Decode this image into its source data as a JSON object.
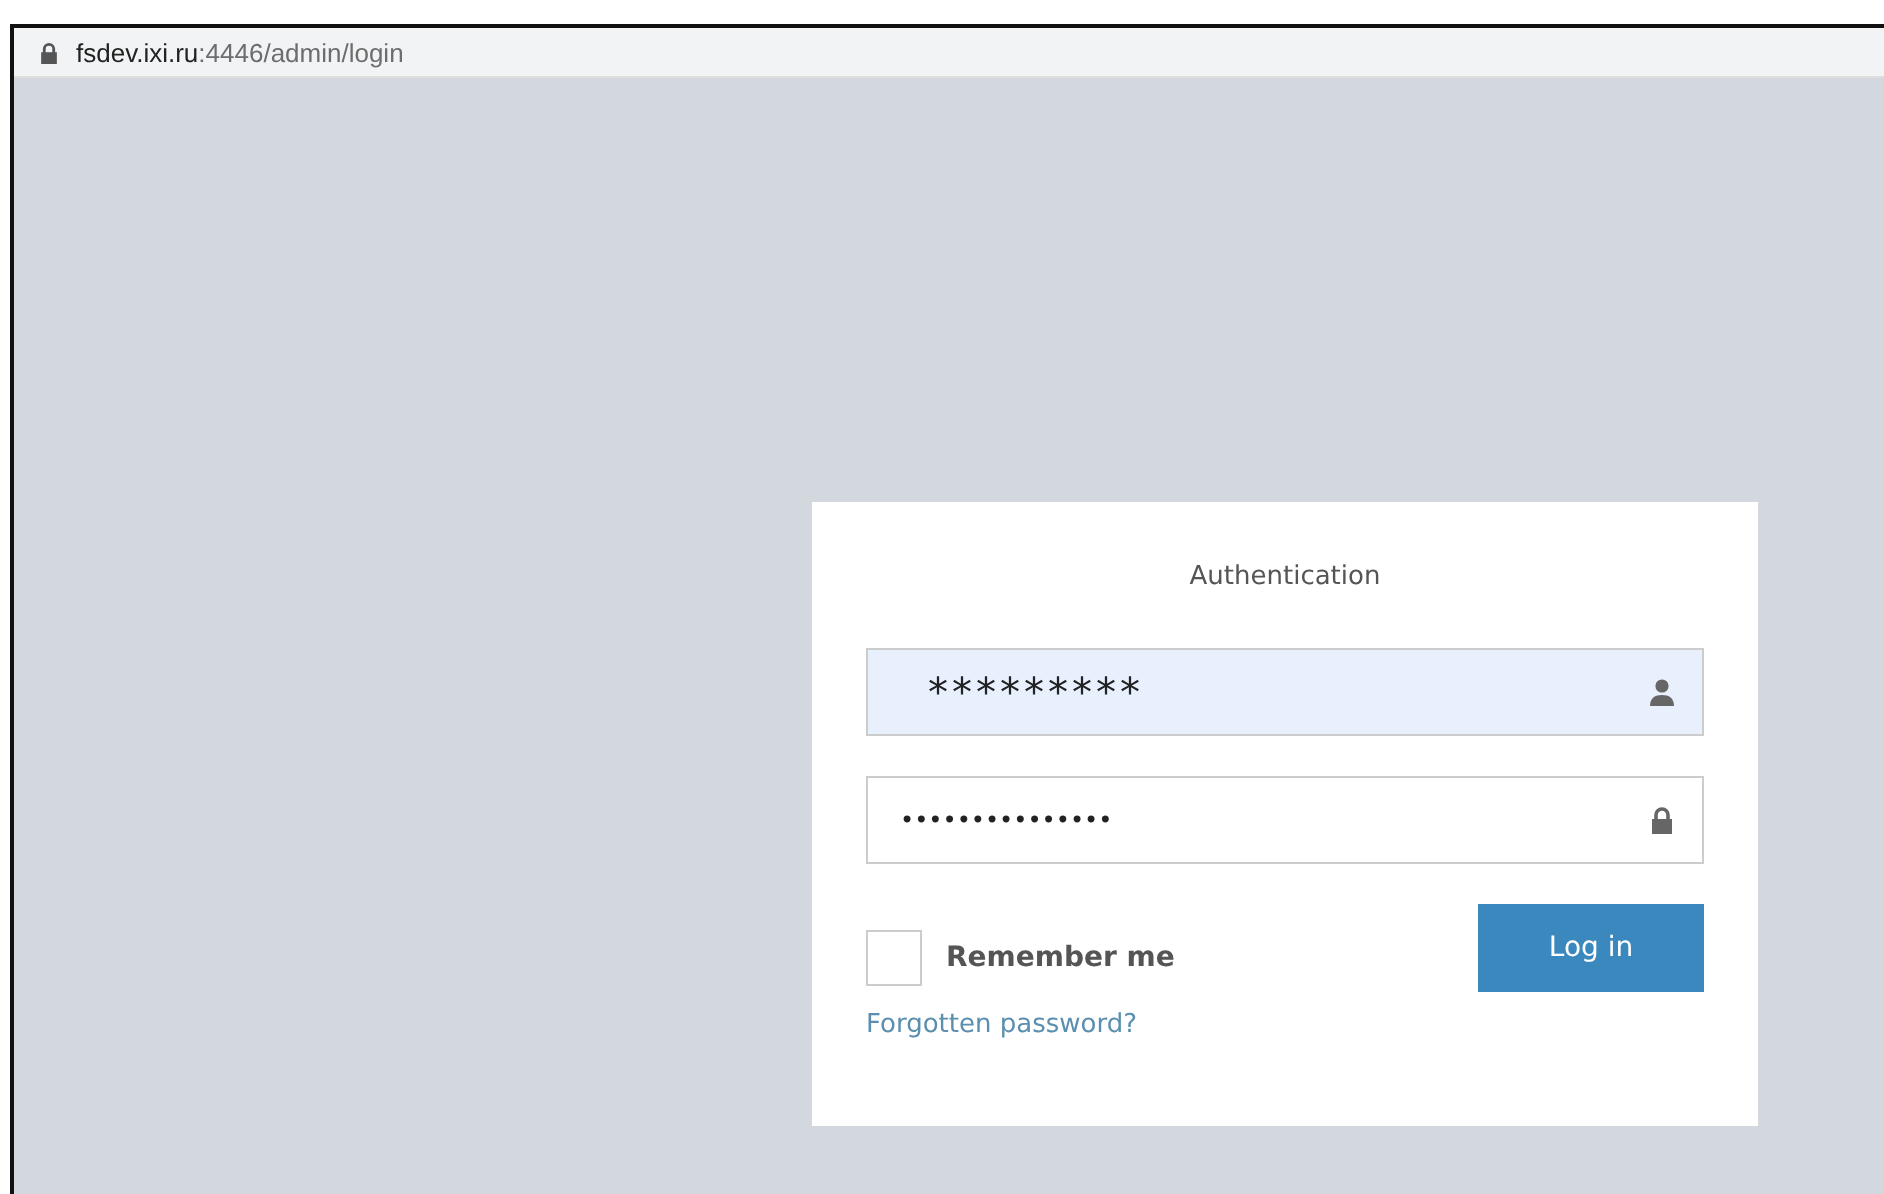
{
  "address_bar": {
    "host": "fsdev.ixi.ru",
    "path": ":4446/admin/login",
    "secure": true
  },
  "login": {
    "title": "Authentication",
    "username": {
      "value": "*********",
      "autofilled": true
    },
    "password": {
      "value": "•••••••••••••••"
    },
    "remember_me": {
      "label": "Remember me",
      "checked": false
    },
    "submit": "Log in",
    "forgot_link": "Forgotten password?"
  }
}
